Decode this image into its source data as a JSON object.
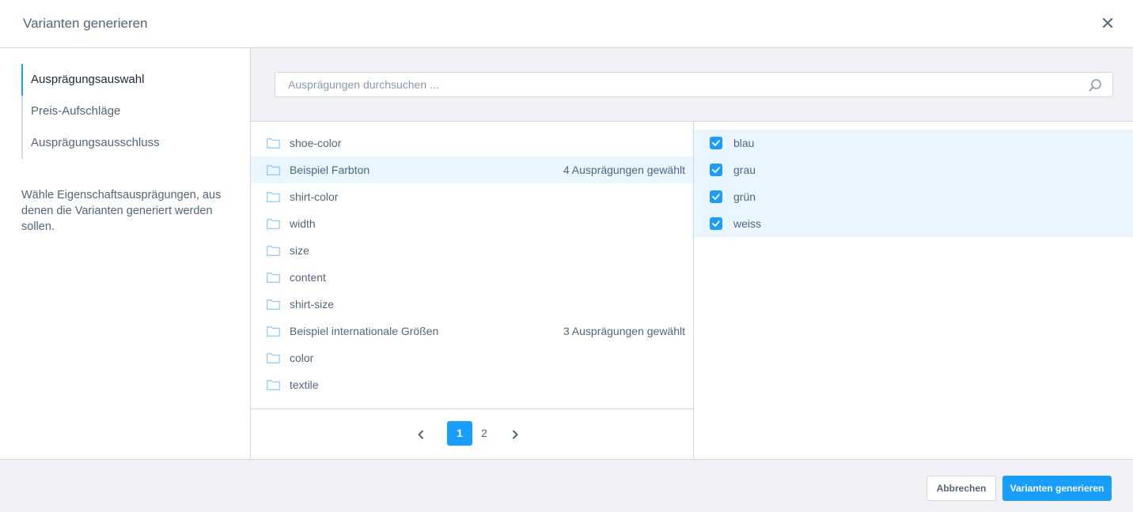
{
  "header": {
    "title": "Varianten generieren"
  },
  "sidebar": {
    "items": [
      {
        "label": "Ausprägungsauswahl",
        "active": true
      },
      {
        "label": "Preis-Aufschläge",
        "active": false
      },
      {
        "label": "Ausprägungsausschluss",
        "active": false
      }
    ],
    "description": "Wähle Eigenschaftsausprägungen, aus denen die Varianten generiert werden sollen."
  },
  "search": {
    "placeholder": "Ausprägungen durchsuchen ..."
  },
  "groups": [
    {
      "name": "shoe-color",
      "count": ""
    },
    {
      "name": "Beispiel Farbton",
      "count": "4 Ausprägungen gewählt",
      "selected": true
    },
    {
      "name": "shirt-color",
      "count": ""
    },
    {
      "name": "width",
      "count": ""
    },
    {
      "name": "size",
      "count": ""
    },
    {
      "name": "content",
      "count": ""
    },
    {
      "name": "shirt-size",
      "count": ""
    },
    {
      "name": "Beispiel internationale Größen",
      "count": "3 Ausprägungen gewählt"
    },
    {
      "name": "color",
      "count": ""
    },
    {
      "name": "textile",
      "count": ""
    }
  ],
  "pagination": {
    "pages": [
      "1",
      "2"
    ],
    "current": "1"
  },
  "options": [
    {
      "label": "blau",
      "checked": true
    },
    {
      "label": "grau",
      "checked": true
    },
    {
      "label": "grün",
      "checked": true
    },
    {
      "label": "weiss",
      "checked": true
    }
  ],
  "footer": {
    "cancel_label": "Abbrechen",
    "generate_label": "Varianten generieren"
  },
  "colors": {
    "accent": "#189eff",
    "selected_bg": "#e9f5ff",
    "text": "#52667a",
    "border": "#d1d9e0",
    "panel_bg": "#f0f2f5"
  }
}
